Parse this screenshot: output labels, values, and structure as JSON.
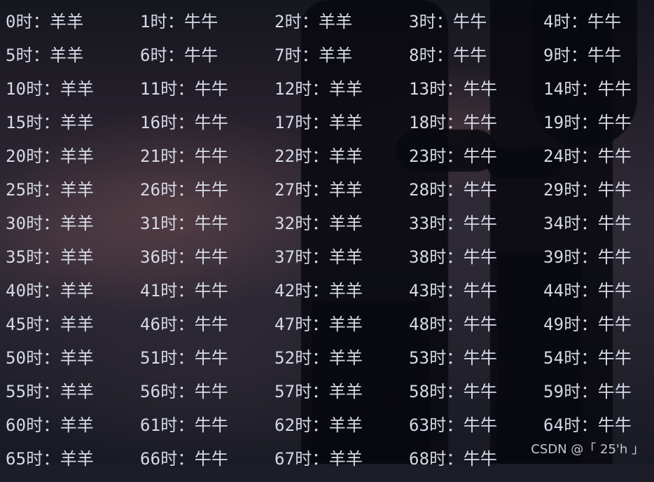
{
  "entries": [
    "0时：羊羊",
    "1时：牛牛",
    "2时：羊羊",
    "3时：牛牛",
    "4时：牛牛",
    "5时：羊羊",
    "6时：牛牛",
    "7时：羊羊",
    "8时：牛牛",
    "9时：牛牛",
    "10时：羊羊",
    "11时：牛牛",
    "12时：羊羊",
    "13时：牛牛",
    "14时：牛牛",
    "15时：羊羊",
    "16时：牛牛",
    "17时：羊羊",
    "18时：牛牛",
    "19时：牛牛",
    "20时：羊羊",
    "21时：牛牛",
    "22时：羊羊",
    "23时：牛牛",
    "24时：牛牛",
    "25时：羊羊",
    "26时：牛牛",
    "27时：羊羊",
    "28时：牛牛",
    "29时：牛牛",
    "30时：羊羊",
    "31时：牛牛",
    "32时：羊羊",
    "33时：牛牛",
    "34时：牛牛",
    "35时：羊羊",
    "36时：牛牛",
    "37时：羊羊",
    "38时：牛牛",
    "39时：牛牛",
    "40时：羊羊",
    "41时：牛牛",
    "42时：羊羊",
    "43时：牛牛",
    "44时：牛牛",
    "45时：羊羊",
    "46时：牛牛",
    "47时：羊羊",
    "48时：牛牛",
    "49时：牛牛",
    "50时：羊羊",
    "51时：牛牛",
    "52时：羊羊",
    "53时：牛牛",
    "54时：牛牛",
    "55时：羊羊",
    "56时：牛牛",
    "57时：羊羊",
    "58时：牛牛",
    "59时：牛牛",
    "60时：羊羊",
    "61时：牛牛",
    "62时：羊羊",
    "63时：牛牛",
    "64时：牛牛",
    "65时：羊羊",
    "66时：牛牛",
    "67时：羊羊",
    "68时：牛牛"
  ],
  "watermark": "CSDN @「 25'h 」"
}
